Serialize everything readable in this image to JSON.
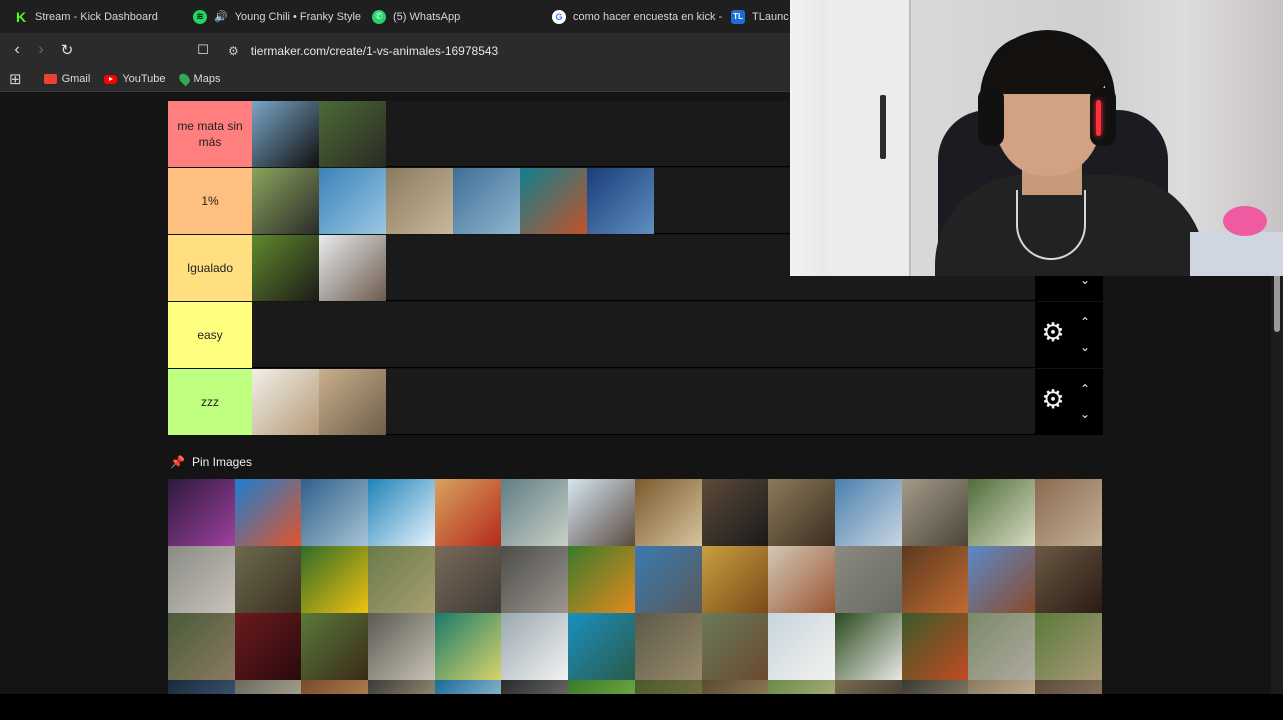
{
  "browser": {
    "tabs": [
      {
        "title": "Stream - Kick Dashboard",
        "icon": "kick-icon"
      },
      {
        "title": "Young Chili • Franky Style",
        "icon": "spotify-icon",
        "audio": true
      },
      {
        "title": "(5) WhatsApp",
        "icon": "whatsapp-icon"
      },
      {
        "title": "como hacer encuesta en kick -",
        "icon": "google-icon"
      },
      {
        "title": "TLaunch",
        "icon": "tlauncher-icon"
      }
    ],
    "url": "tiermaker.com/create/1-vs-animales-16978543",
    "bookmarks": [
      {
        "label": "Gmail",
        "icon": "gmail-icon"
      },
      {
        "label": "YouTube",
        "icon": "youtube-icon"
      },
      {
        "label": "Maps",
        "icon": "maps-icon"
      }
    ]
  },
  "tiers": [
    {
      "label": "me mata sin más",
      "color": "#ff7f7f",
      "items": [
        [
          "#7aa6c8",
          "#101010"
        ],
        [
          "#4b6a38",
          "#2a2a22"
        ]
      ]
    },
    {
      "label": "1%",
      "color": "#ffbf7f",
      "items": [
        [
          "#8aa45a",
          "#2b2b2b"
        ],
        [
          "#3a82b8",
          "#9cc7e2"
        ],
        [
          "#8a7a60",
          "#c9b89a"
        ],
        [
          "#3f6f97",
          "#8fb6cf"
        ],
        [
          "#0f7f8e",
          "#c2532a"
        ],
        [
          "#1a3d7a",
          "#5f8fc0"
        ]
      ]
    },
    {
      "label": "Igualado",
      "color": "#ffdf7f",
      "items": [
        [
          "#5e8a2d",
          "#1e1a18"
        ],
        [
          "#e7ecef",
          "#6d5a4d"
        ]
      ]
    },
    {
      "label": "easy",
      "color": "#ffff7f",
      "items": []
    },
    {
      "label": "zzz",
      "color": "#bfff7f",
      "items": [
        [
          "#f2efe8",
          "#b59a78"
        ],
        [
          "#c9b08c",
          "#6f5e4a"
        ]
      ]
    }
  ],
  "pin_images": {
    "label": "Pin Images",
    "items": [
      [
        "#2a1a3a",
        "#a040a0"
      ],
      [
        "#1b7fd1",
        "#e2542a"
      ],
      [
        "#2e5f8a",
        "#a7c4d6"
      ],
      [
        "#1f82b7",
        "#e6f3fb"
      ],
      [
        "#d9a25e",
        "#b32a1c"
      ],
      [
        "#5f7d86",
        "#c9d0c6"
      ],
      [
        "#d6e6f1",
        "#5b4a40"
      ],
      [
        "#7a5a2e",
        "#d8c49c"
      ],
      [
        "#5c4a3a",
        "#1a1a1a"
      ],
      [
        "#8c7a5a",
        "#3a2e22"
      ],
      [
        "#4a7fb0",
        "#c9d6e0"
      ],
      [
        "#a49a8a",
        "#4c4638"
      ],
      [
        "#4f6d3a",
        "#d7dbc2"
      ],
      [
        "#8a6a50",
        "#c6b296"
      ],
      [
        "#8a8a86",
        "#c9c4ba"
      ],
      [
        "#6d6a50",
        "#3a3020"
      ],
      [
        "#2f6b2a",
        "#f0c20e"
      ],
      [
        "#6a7a4a",
        "#a8a070"
      ],
      [
        "#7a6a5a",
        "#3e3a34"
      ],
      [
        "#4c4c48",
        "#9c9690"
      ],
      [
        "#3a7a2a",
        "#e48a20"
      ],
      [
        "#3a7ab0",
        "#5a5a5a"
      ],
      [
        "#c8a040",
        "#7a4a18"
      ],
      [
        "#d2c8b8",
        "#9a5530"
      ],
      [
        "#8a8a82",
        "#6a6a64"
      ],
      [
        "#5a3a20",
        "#c36a30"
      ],
      [
        "#5a8ac8",
        "#8a4a2a"
      ],
      [
        "#6a5a44",
        "#2a1a14"
      ],
      [
        "#4a5a3a",
        "#8c7a60"
      ],
      [
        "#6a1a1e",
        "#2a0a0c"
      ],
      [
        "#5a7a3a",
        "#3a2a18"
      ],
      [
        "#5a5a52",
        "#c8c2b4"
      ],
      [
        "#1a7a6a",
        "#d8d46a"
      ],
      [
        "#9aa8b0",
        "#f2f2f2"
      ],
      [
        "#1a90c0",
        "#2a5a4a"
      ],
      [
        "#5a5a4a",
        "#9a8a6a"
      ],
      [
        "#6a7a5a",
        "#6a4a30"
      ],
      [
        "#c8d4de",
        "#f2f2ee"
      ],
      [
        "#2a4a1e",
        "#e8e8e4"
      ],
      [
        "#3a5a2a",
        "#c24a22"
      ],
      [
        "#7a8a6a",
        "#b0aaa0"
      ],
      [
        "#5a7a3a",
        "#a89a78"
      ],
      [
        "#1a2a3a",
        "#4a6a8a"
      ],
      [
        "#6a6a5a",
        "#c8c0b0"
      ],
      [
        "#7a4a2a",
        "#c89a60"
      ],
      [
        "#3a3a3a",
        "#c8b890"
      ],
      [
        "#1a6a9a",
        "#c8e0ea"
      ],
      [
        "#2a2a2a",
        "#8a8a8a"
      ],
      [
        "#3a7a2a",
        "#8ac050"
      ],
      [
        "#4a5a2a",
        "#8a7a50"
      ],
      [
        "#5a4a30",
        "#a8946a"
      ],
      [
        "#6a8a4a",
        "#c8c090"
      ],
      [
        "#7a6a50",
        "#2a2a22"
      ],
      [
        "#3a3a32",
        "#a89a80"
      ],
      [
        "#8a7a60",
        "#d8c8a8"
      ],
      [
        "#5a4a3a",
        "#9a8a70"
      ]
    ]
  }
}
